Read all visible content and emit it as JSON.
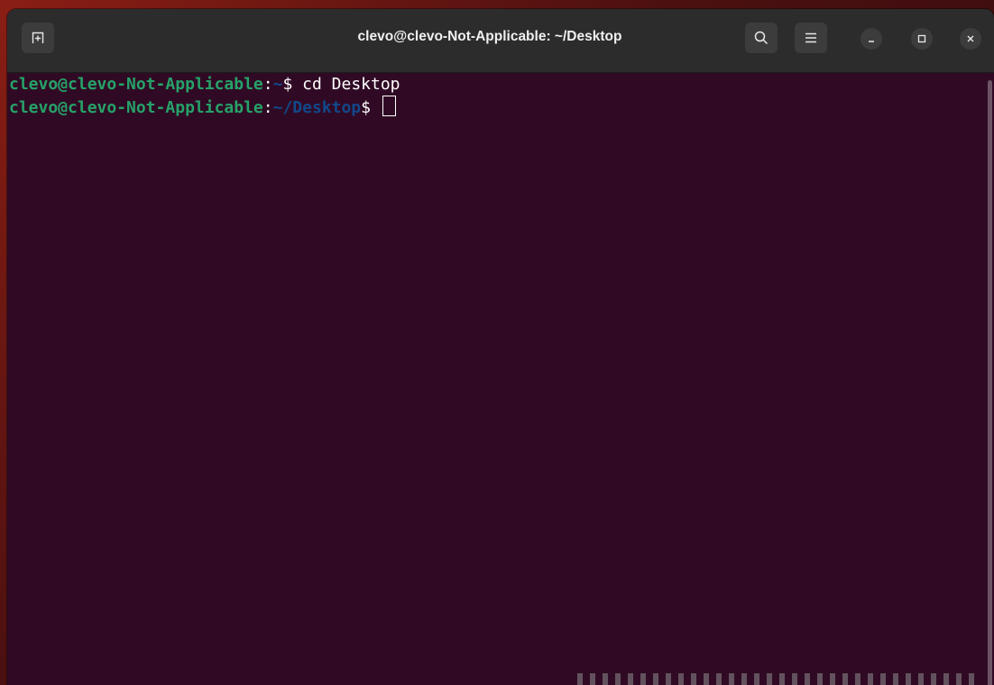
{
  "window": {
    "title": "clevo@clevo-Not-Applicable: ~/Desktop"
  },
  "titlebar": {
    "icons": {
      "new_tab": "new-tab-icon",
      "search": "search-icon",
      "menu": "hamburger-menu-icon",
      "minimize": "minimize-icon",
      "maximize": "maximize-icon",
      "close": "close-icon"
    }
  },
  "terminal": {
    "lines": [
      {
        "user_host": "clevo@clevo-Not-Applicable",
        "colon": ":",
        "path": "~",
        "prompt": "$ ",
        "command": "cd Desktop"
      },
      {
        "user_host": "clevo@clevo-Not-Applicable",
        "colon": ":",
        "path": "~/Desktop",
        "prompt": "$ ",
        "command": ""
      }
    ]
  },
  "colors": {
    "terminal_bg": "#300a24",
    "user_host": "#26a269",
    "path": "#12488b",
    "titlebar_bg": "#2c2c2c"
  }
}
